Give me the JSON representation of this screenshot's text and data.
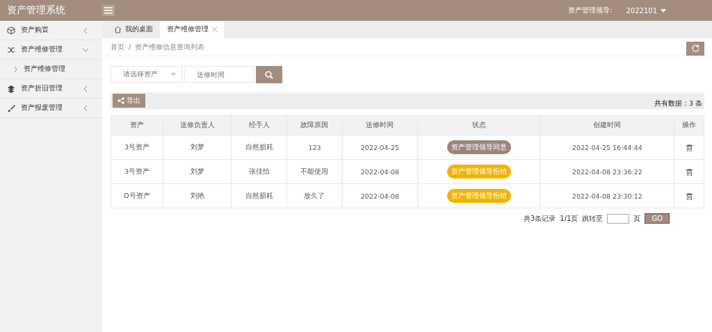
{
  "header": {
    "title": "资产管理系统",
    "user_label": "资产管理领导:",
    "user_name": "2022101"
  },
  "sidebar": {
    "items": [
      {
        "label": "资产购置",
        "expanded": false
      },
      {
        "label": "资产维修管理",
        "expanded": true,
        "children": [
          {
            "label": "资产维修管理"
          }
        ]
      },
      {
        "label": "资产折旧管理",
        "expanded": false
      },
      {
        "label": "资产报废管理",
        "expanded": false
      }
    ]
  },
  "tabs": [
    {
      "label": "我的桌面",
      "selected": false,
      "closable": false
    },
    {
      "label": "资产维修管理",
      "selected": true,
      "closable": true
    }
  ],
  "breadcrumb": [
    "首页",
    "/",
    "资产维修信息查询列表"
  ],
  "filters": {
    "asset_select": {
      "placeholder": "请选择资产"
    },
    "date_field": {
      "placeholder": "送修时间"
    }
  },
  "toolbar": {
    "export_button": "导出",
    "total": "共有数据：3 条"
  },
  "table": {
    "columns": [
      "资产",
      "送修负责人",
      "经手人",
      "故障原因",
      "送修时间",
      "状态",
      "创建时间",
      "操作"
    ],
    "rows": [
      {
        "cells": [
          "3号资产",
          "刘梦",
          "自然损耗",
          "123",
          "2022-04-25"
        ],
        "status": {
          "text": "资产管理领导同意",
          "color": "#9b8579"
        },
        "created": "2022-04-25 16:44:44"
      },
      {
        "cells": [
          "3号资产",
          "刘梦",
          "张佳怡",
          "不能使用",
          "2022-04-08"
        ],
        "status": {
          "text": "资产管理领导拒绝",
          "color": "#f1b400"
        },
        "created": "2022-04-08 23:36:22"
      },
      {
        "cells": [
          "D号资产",
          "刘艳",
          "自然损耗",
          "放久了",
          "2022-04-08"
        ],
        "status": {
          "text": "资产管理领导拒绝",
          "color": "#f1b400"
        },
        "created": "2022-04-08 23:30:12"
      }
    ]
  },
  "pagination": {
    "summary": "共3条记录",
    "pages": "1/1页",
    "jump_label": "跳转至",
    "page_unit": "页",
    "go_button": "GO"
  }
}
